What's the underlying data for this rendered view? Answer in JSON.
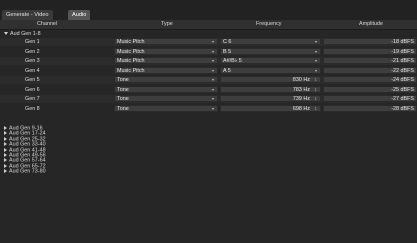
{
  "tabs": [
    {
      "label": "Generate - Video",
      "active": false
    },
    {
      "label": "Audio",
      "active": true
    }
  ],
  "columns": {
    "channel": "Channel",
    "type": "Type",
    "frequency": "Frequency",
    "amplitude": "Amplitude"
  },
  "group_open": "Aud Gen 1-8",
  "rows": [
    {
      "name": "Gen 1",
      "type": "Music Pitch",
      "freq": "C 6",
      "amp": "-18 dBFS",
      "freq_kind": "select"
    },
    {
      "name": "Gen 2",
      "type": "Music Pitch",
      "freq": "B 5",
      "amp": "-19 dBFS",
      "freq_kind": "select"
    },
    {
      "name": "Gen 3",
      "type": "Music Pitch",
      "freq": "A#/B♭ 5",
      "amp": "-21 dBFS",
      "freq_kind": "select"
    },
    {
      "name": "Gen 4",
      "type": "Music Pitch",
      "freq": "A 5",
      "amp": "-22 dBFS",
      "freq_kind": "select"
    },
    {
      "name": "Gen 5",
      "type": "Tone",
      "freq": "830 Hz",
      "amp": "-24 dBFS",
      "freq_kind": "spin"
    },
    {
      "name": "Gen 6",
      "type": "Tone",
      "freq": "783 Hz",
      "amp": "-25 dBFS",
      "freq_kind": "spin"
    },
    {
      "name": "Gen 7",
      "type": "Tone",
      "freq": "739 Hz",
      "amp": "-27 dBFS",
      "freq_kind": "spin"
    },
    {
      "name": "Gen 8",
      "type": "Tone",
      "freq": "698 Hz",
      "amp": "-28 dBFS",
      "freq_kind": "spin"
    }
  ],
  "collapsed_groups": [
    "Aud Gen 9-16",
    "Aud Gen 17-24",
    "Aud Gen 25-32",
    "Aud Gen 33-40",
    "Aud Gen 41-48",
    "Aud Gen 49-56",
    "Aud Gen 57-64",
    "Aud Gen 65-72",
    "Aud Gen 73-80"
  ]
}
